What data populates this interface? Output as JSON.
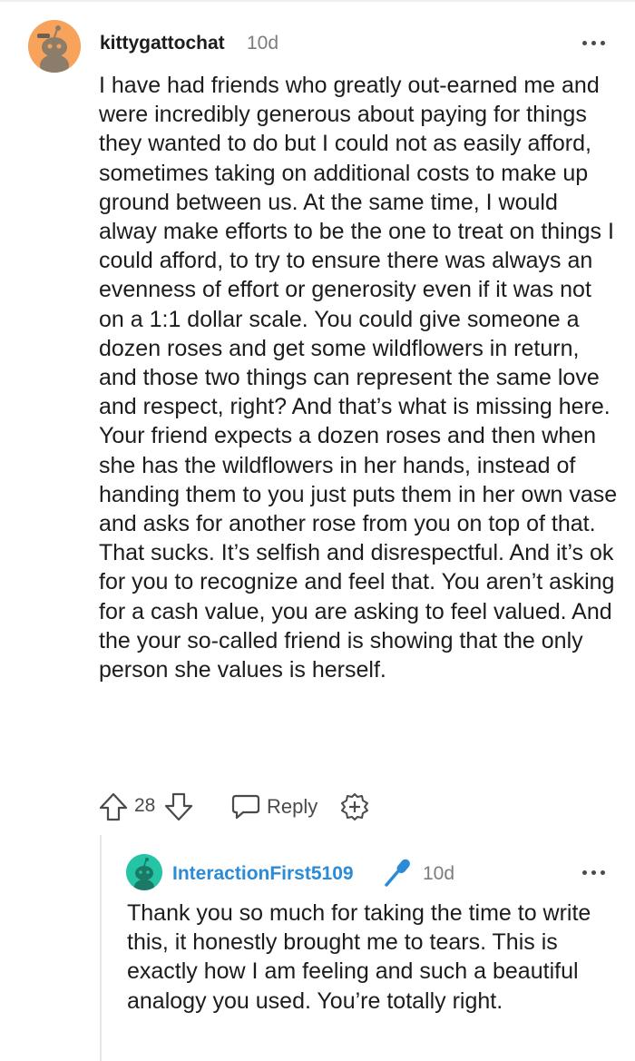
{
  "comment": {
    "author": "kittygattochat",
    "time": "10d",
    "body": "I have had friends who greatly out-earned me and were incredibly generous about paying for things they wanted to do but I could not as easily afford, sometimes taking on additional costs to make up ground between us. At the same time, I would alway make efforts to be the one to treat on things I could afford, to try to ensure there was always an evenness of effort or generosity even if it was not on a 1:1 dollar scale. You could give someone a dozen roses and get some wildflowers in return, and those two things can represent the same love and respect, right? And that’s what is missing here. Your friend expects a dozen roses and then when she has the wildflowers in her hands, instead of handing them to you just puts them in her own vase and asks for another rose from you on top of that. That sucks. It’s selfish and disrespectful. And it’s ok for you to recognize and feel that. You aren’t asking for a cash value, you are asking to feel valued. And the your so-called friend is showing that the only person she values is herself.",
    "score": "28",
    "reply_label": "Reply",
    "avatar_color": "#f7a35c",
    "icons": {
      "more": "more-horizontal-icon",
      "upvote": "arrow-up-icon",
      "downvote": "arrow-down-icon",
      "reply": "speech-bubble-icon",
      "award": "award-plus-icon"
    }
  },
  "reply": {
    "author": "InteractionFirst5109",
    "time": "10d",
    "body": "Thank you so much for taking the time to write this, it honestly brought me to tears. This is exactly how I am feeling and such a beautiful analogy you used. You’re totally right.",
    "author_color": "#2b8bd6",
    "avatar_color": "#24c4a5",
    "icons": {
      "flair": "microphone-icon",
      "more": "more-horizontal-icon"
    }
  }
}
